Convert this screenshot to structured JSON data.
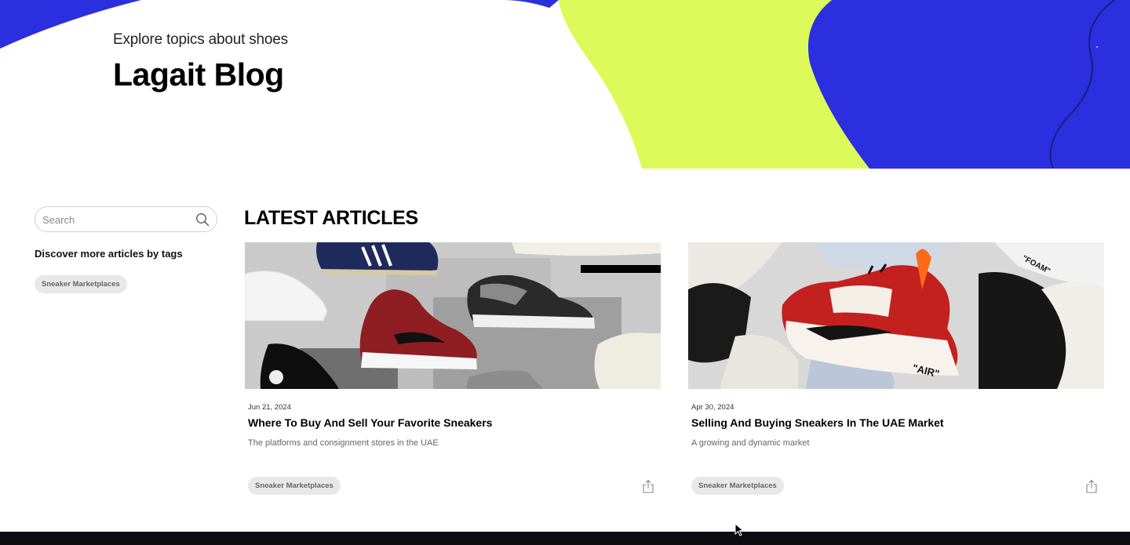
{
  "hero": {
    "subtitle": "Explore topics about shoes",
    "title": "Lagait Blog",
    "colors": {
      "blue": "#2b2fe0",
      "lime": "#dcfb5a"
    }
  },
  "sidebar": {
    "search_placeholder": "Search",
    "search_icon": "search-icon",
    "tags_heading": "Discover more articles by tags",
    "tags": [
      {
        "label": "Sneaker Marketplaces"
      }
    ]
  },
  "main": {
    "section_title": "LATEST ARTICLES",
    "articles": [
      {
        "date": "Jun 21, 2024",
        "title": "Where To Buy And Sell Your Favorite Sneakers",
        "description": "The platforms and consignment stores in the UAE",
        "tag": "Sneaker Marketplaces",
        "share_icon": "share-icon"
      },
      {
        "date": "Apr 30, 2024",
        "title": "Selling And Buying Sneakers In The UAE Market",
        "description": "A growing and dynamic market",
        "tag": "Sneaker Marketplaces",
        "share_icon": "share-icon"
      }
    ]
  }
}
